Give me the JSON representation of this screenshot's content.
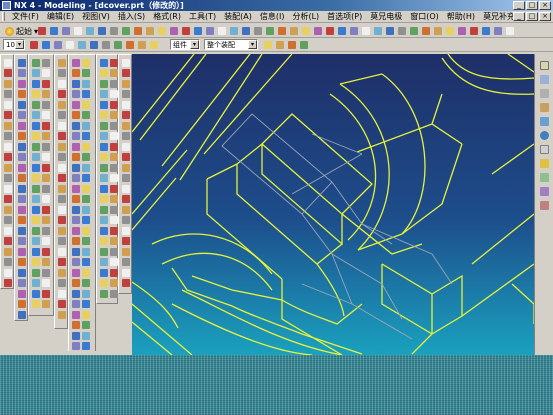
{
  "window": {
    "title": "NX 4 - Modeling - [dcover.prt（修改的）]"
  },
  "menubar": {
    "items": [
      {
        "label": "文件(F)"
      },
      {
        "label": "编辑(E)"
      },
      {
        "label": "视图(V)"
      },
      {
        "label": "插入(S)"
      },
      {
        "label": "格式(R)"
      },
      {
        "label": "工具(T)"
      },
      {
        "label": "装配(A)"
      },
      {
        "label": "信息(I)"
      },
      {
        "label": "分析(L)"
      },
      {
        "label": "首选项(P)"
      },
      {
        "label": "莫兄电极"
      },
      {
        "label": "窗口(O)"
      },
      {
        "label": "帮助(H)"
      },
      {
        "label": "莫兄补充"
      }
    ]
  },
  "toolbar": {
    "start_label": "起始",
    "zoom_value": "100",
    "filter_value": "组件",
    "assembly_value": "整个装配"
  },
  "colors": {
    "wireframe": "#e6f23a",
    "hidden_edges": "#9aa6b8",
    "background_top": "#1f2f68",
    "background_bottom": "#1aa1bf"
  }
}
